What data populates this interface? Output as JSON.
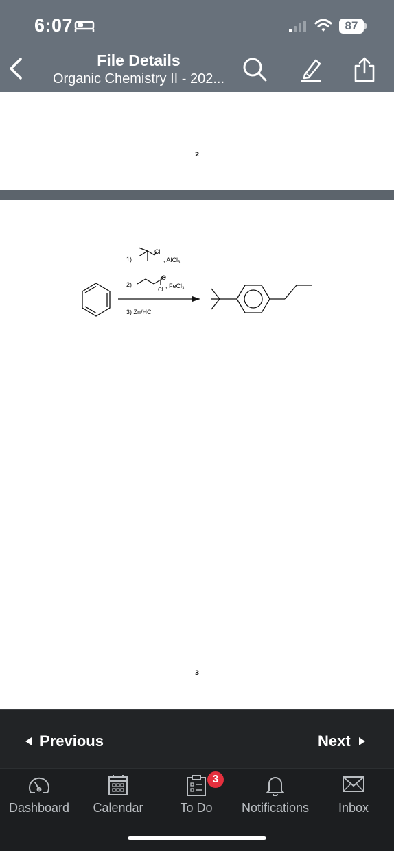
{
  "status_bar": {
    "time": "6:07",
    "battery": "87"
  },
  "header": {
    "title": "File Details",
    "subtitle": "Organic Chemistry II - 202..."
  },
  "document": {
    "page_numbers": [
      "2",
      "3"
    ],
    "scheme": {
      "step1_label": "1)",
      "step1_reagent_atom": "Cl",
      "step1_catalyst": ", AlCl",
      "step1_catalyst_sub": "3",
      "step2_label": "2)",
      "step2_o": "O",
      "step2_cl": "Cl",
      "step2_catalyst": ", FeCl",
      "step2_catalyst_sub": "3",
      "step3": "3) Zn/HCl"
    }
  },
  "pager": {
    "previous_label": "Previous",
    "next_label": "Next"
  },
  "tabs": [
    {
      "label": "Dashboard",
      "icon": "dashboard-gauge-icon"
    },
    {
      "label": "Calendar",
      "icon": "calendar-icon"
    },
    {
      "label": "To Do",
      "icon": "todo-clipboard-icon",
      "badge": "3"
    },
    {
      "label": "Notifications",
      "icon": "bell-icon"
    },
    {
      "label": "Inbox",
      "icon": "envelope-icon"
    }
  ],
  "colors": {
    "header_bg": "#68717b",
    "tabbar_bg": "#1c1e20",
    "badge": "#e5303e"
  }
}
